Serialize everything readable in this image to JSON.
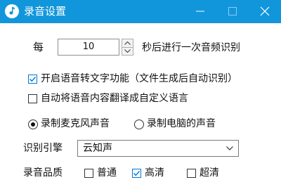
{
  "window": {
    "title": "录音设置",
    "titlebar_color": "#1296db",
    "icons": {
      "app": "music-note-icon",
      "minimize": "minimize-icon",
      "maximize": "maximize-icon",
      "close": "close-icon"
    }
  },
  "interval": {
    "prefix": "每",
    "value": "10",
    "suffix": "秒后进行一次音频识别"
  },
  "options": {
    "speech_to_text": {
      "label": "开启语音转文字功能（文件生成后自动识别）",
      "checked": true
    },
    "translate": {
      "label": "自动将语音内容翻译成自定义语言",
      "checked": false
    }
  },
  "source": {
    "microphone": {
      "label": "录制麦克风声音",
      "selected": true
    },
    "computer": {
      "label": "录制电脑的声音",
      "selected": false
    }
  },
  "engine": {
    "label": "识别引擎",
    "value": "云知声"
  },
  "quality": {
    "label": "录音品质",
    "options": [
      {
        "label": "普通",
        "checked": false
      },
      {
        "label": "高清",
        "checked": true
      },
      {
        "label": "超清",
        "checked": false
      }
    ]
  },
  "colors": {
    "accent": "#0078d7"
  }
}
